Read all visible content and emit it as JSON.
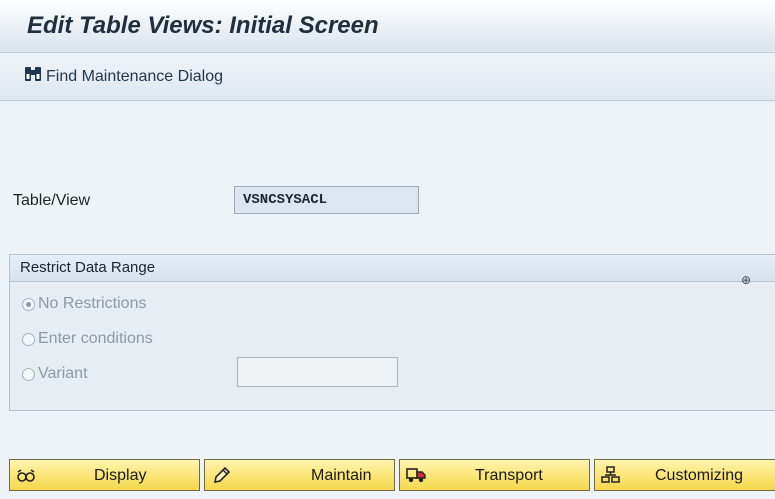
{
  "window": {
    "title": "Edit Table Views: Initial Screen"
  },
  "toolbar": {
    "find_label": "Find Maintenance Dialog"
  },
  "form": {
    "table_view_label": "Table/View",
    "table_view_value": "VSNCSYSACL"
  },
  "restrict": {
    "title": "Restrict Data Range",
    "options": [
      {
        "label": "No Restrictions",
        "selected": true
      },
      {
        "label": "Enter conditions",
        "selected": false
      },
      {
        "label": "Variant",
        "selected": false
      }
    ],
    "variant_value": ""
  },
  "actions": {
    "display": "Display",
    "maintain": "Maintain",
    "transport": "Transport",
    "customizing": "Customizing"
  },
  "colors": {
    "button_fill": "#fbe77a",
    "background": "#eef3f7",
    "disabled_text": "#8d9aa6"
  }
}
